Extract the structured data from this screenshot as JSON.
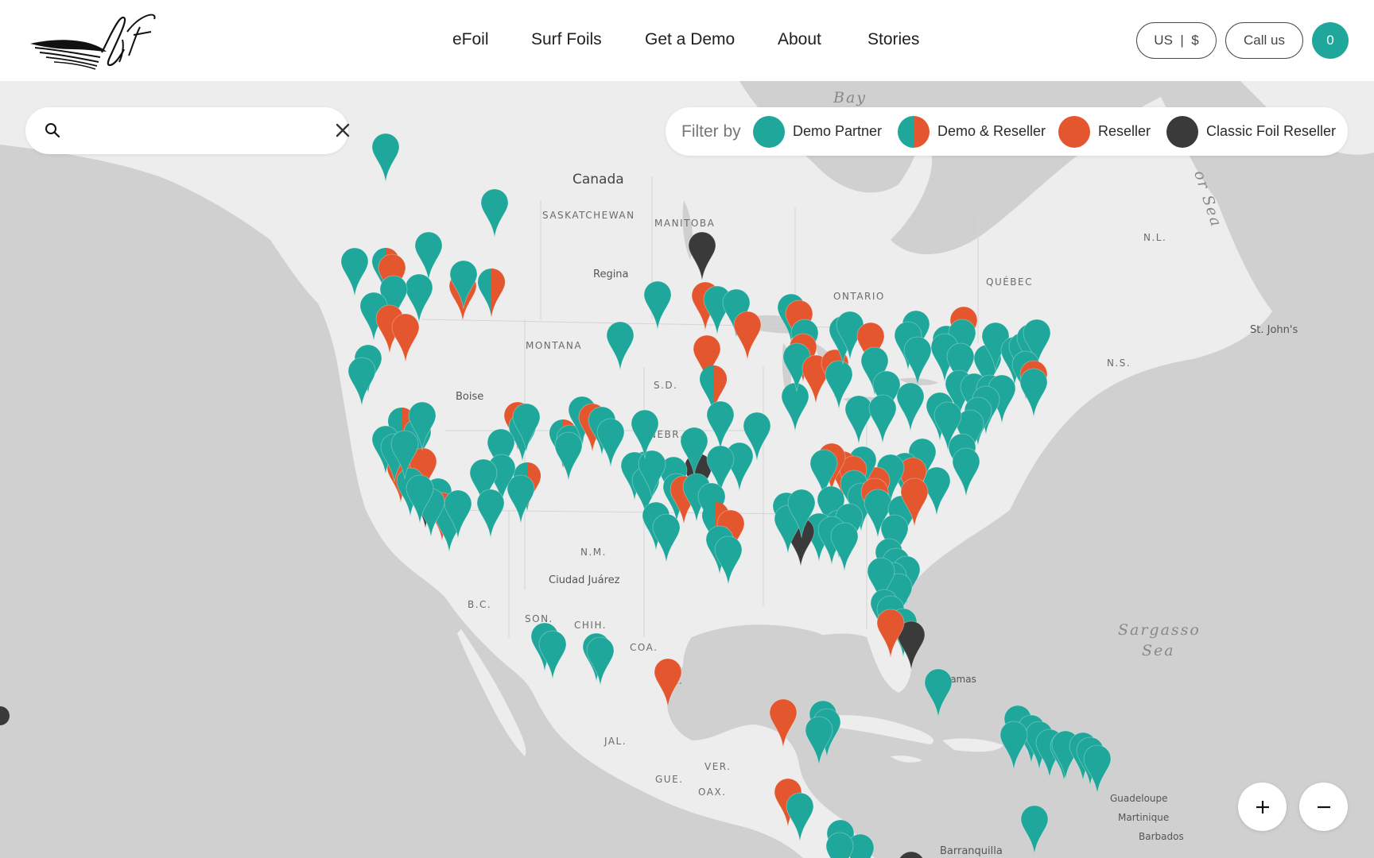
{
  "header": {
    "nav": [
      {
        "label": "eFoil"
      },
      {
        "label": "Surf Foils"
      },
      {
        "label": "Get a Demo"
      },
      {
        "label": "About"
      },
      {
        "label": "Stories"
      }
    ],
    "region_currency": "US  |  $",
    "call_label": "Call us",
    "cart_count": "0"
  },
  "search": {
    "value": "",
    "placeholder": ""
  },
  "filter": {
    "title": "Filter by",
    "items": [
      {
        "label": "Demo Partner",
        "type": "demo"
      },
      {
        "label": "Demo & Reseller",
        "type": "both"
      },
      {
        "label": "Reseller",
        "type": "reseller"
      },
      {
        "label": "Classic Foil Reseller",
        "type": "classic"
      }
    ]
  },
  "colors": {
    "demo": "#1ea79a",
    "reseller": "#e4572e",
    "classic": "#3a3a3a",
    "land": "#ededed",
    "water": "#cfd0cf"
  },
  "map": {
    "labels": {
      "canada": "Canada",
      "saskatchewan": "SASKATCHEWAN",
      "manitoba": "MANITOBA",
      "ontario": "ONTARIO",
      "quebec": "QUÉBEC",
      "nl": "N.L.",
      "ns": "N.S.",
      "regina": "Regina",
      "montana": "MONTANA",
      "boise": "Boise",
      "sd": "S.D.",
      "nebr": "NEBR.",
      "nm": "N.M.",
      "ciudad_juarez": "Ciudad Juárez",
      "bc": "B.C.",
      "son": "SON.",
      "chih": "CHIH.",
      "coa": "COA.",
      "nl_mx": "N.L.",
      "jal": "JAL.",
      "gue": "GUE.",
      "ver": "VER.",
      "oax": "OAX.",
      "st_johns": "St. John's",
      "hudson_bay": "Bay",
      "sargasso": "Sargasso",
      "sargasso2": "Sea",
      "labrador_sea": "or Sea",
      "bahamas": "Bahamas",
      "guadeloupe": "Guadeloupe",
      "martinique": "Martinique",
      "barbados": "Barbados",
      "barranquilla": "Barranquilla"
    }
  }
}
